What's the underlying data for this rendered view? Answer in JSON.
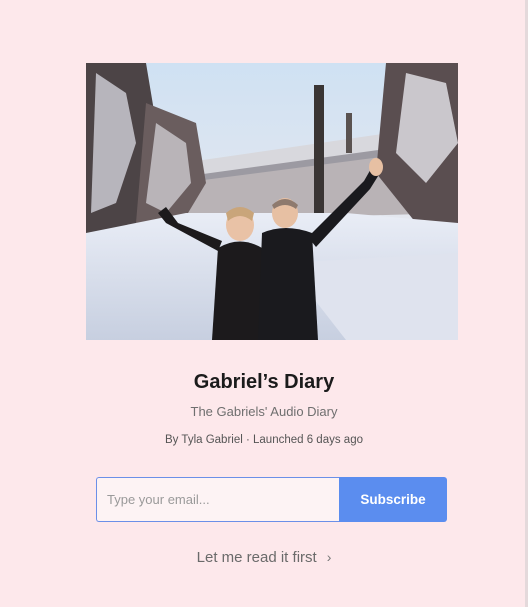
{
  "publication": {
    "title": "Gabriel’s Diary",
    "tagline": "The Gabriels' Audio Diary",
    "byline": "By Tyla Gabriel · Launched 6 days ago"
  },
  "subscribe": {
    "email_placeholder": "Type your email...",
    "button_label": "Subscribe"
  },
  "read_first": {
    "label": "Let me read it first",
    "icon": "chevron-right-icon"
  },
  "colors": {
    "background": "#fde8eb",
    "accent": "#5b8def",
    "input_border": "#6b8fe8"
  }
}
